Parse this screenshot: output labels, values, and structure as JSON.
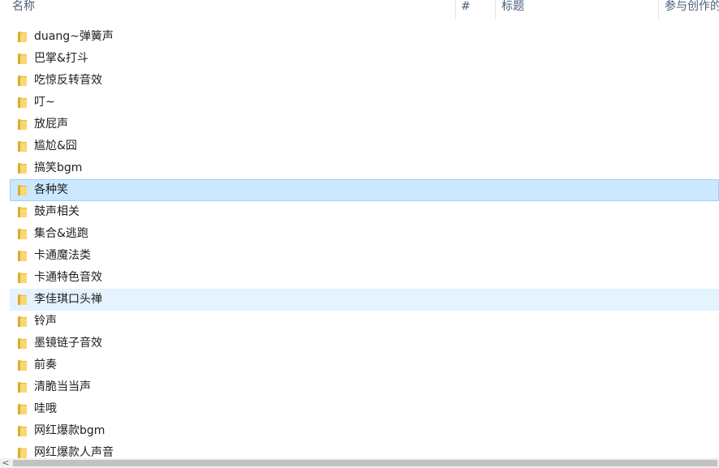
{
  "columns": {
    "name": "名称",
    "number": "#",
    "title": "标题",
    "contributing": "参与创作的"
  },
  "items": [
    {
      "label": "duang~弹簧声"
    },
    {
      "label": "巴掌&打斗"
    },
    {
      "label": "吃惊反转音效"
    },
    {
      "label": "叮~"
    },
    {
      "label": "放屁声"
    },
    {
      "label": "尴尬&囧"
    },
    {
      "label": "搞笑bgm"
    },
    {
      "label": "各种笑",
      "state": "selected"
    },
    {
      "label": "鼓声相关"
    },
    {
      "label": "集合&逃跑"
    },
    {
      "label": "卡通魔法类"
    },
    {
      "label": "卡通特色音效"
    },
    {
      "label": "李佳琪口头禅",
      "state": "hover"
    },
    {
      "label": "铃声"
    },
    {
      "label": "墨镜链子音效"
    },
    {
      "label": "前奏"
    },
    {
      "label": "清脆当当声"
    },
    {
      "label": "哇哦"
    },
    {
      "label": "网红爆款bgm"
    },
    {
      "label": "网红爆款人声音"
    }
  ],
  "colors": {
    "selected_bg": "#cce8ff",
    "hover_bg": "#e5f3ff",
    "folder_yellow": "#f8d775"
  },
  "icons": {
    "folder": "folder-icon",
    "scroll_left": "chevron-left-icon"
  },
  "scrollbar": {
    "left_arrow": "<"
  }
}
